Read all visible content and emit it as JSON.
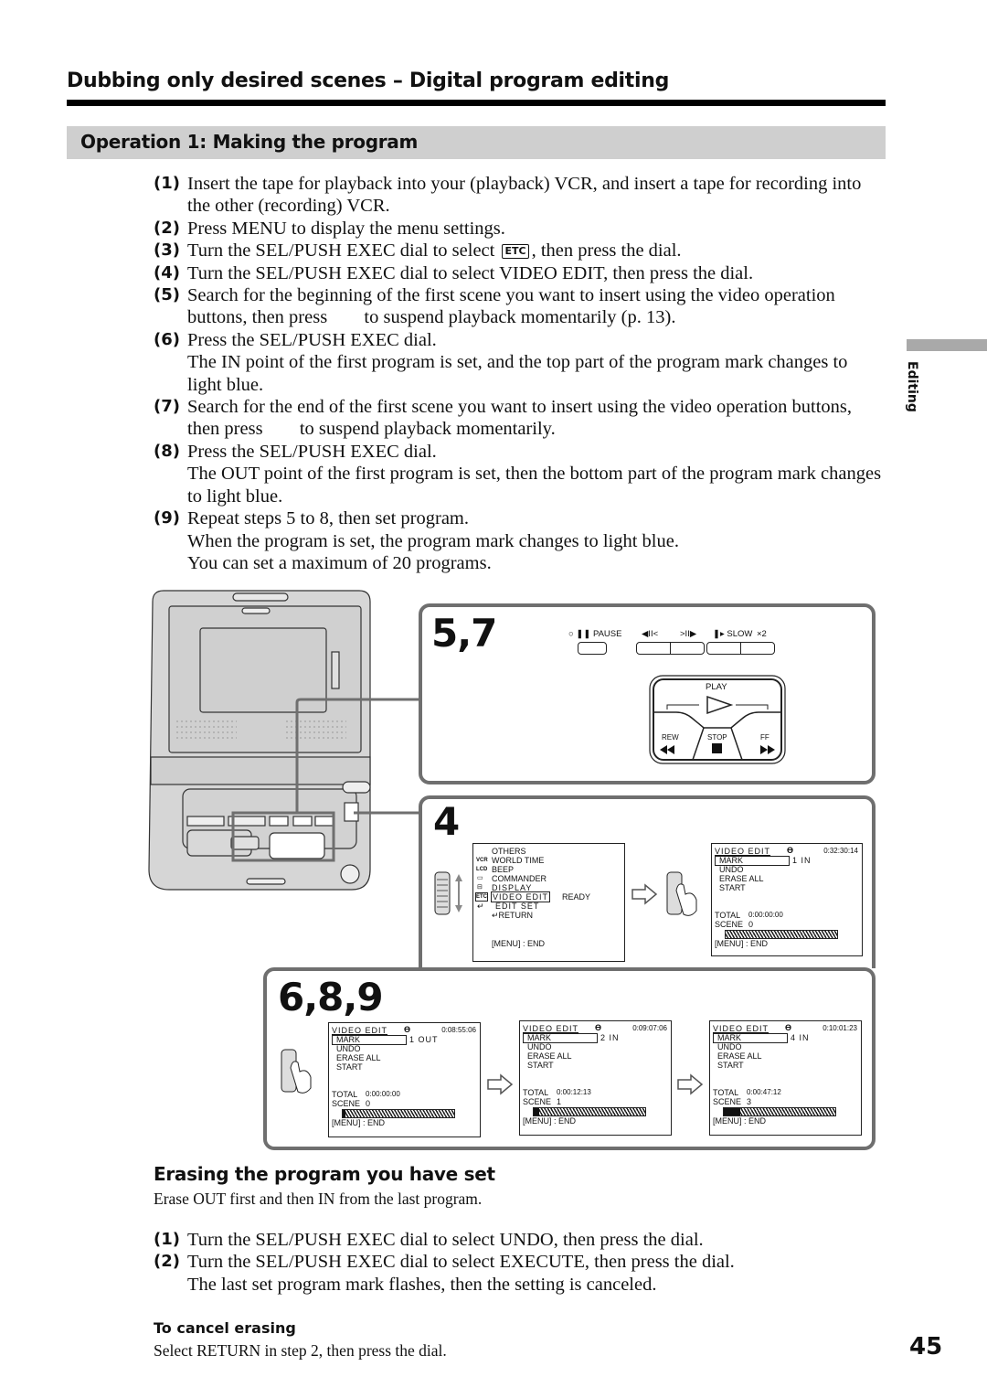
{
  "header": {
    "title": "Dubbing only desired scenes – Digital program editing",
    "section": "Operation 1: Making the program"
  },
  "side_tab": {
    "label": "Editing"
  },
  "steps": [
    {
      "num": "(1)",
      "text": "Insert the tape for playback into your (playback) VCR, and insert a tape for recording into the other (recording) VCR."
    },
    {
      "num": "(2)",
      "text": "Press MENU to display the menu settings."
    },
    {
      "num": "(3)",
      "text_before": "Turn the SEL/PUSH EXEC dial to select ",
      "icon": "ETC",
      "text_after": ", then press the dial."
    },
    {
      "num": "(4)",
      "text": "Turn the SEL/PUSH EXEC dial to select VIDEO EDIT, then press the dial."
    },
    {
      "num": "(5)",
      "text_before": "Search for the beginning of the first scene you want to insert using the video operation buttons, then press ",
      "text_after": " to suspend playback momentarily (p. 13)."
    },
    {
      "num": "(6)",
      "text": "Press the SEL/PUSH EXEC dial.",
      "note": "The IN point of the first program is set, and the top part of the program mark changes to light blue."
    },
    {
      "num": "(7)",
      "text_before": "Search for the end of the first scene you want to insert using the video operation buttons, then press ",
      "text_after": " to suspend playback momentarily."
    },
    {
      "num": "(8)",
      "text": "Press the SEL/PUSH EXEC dial.",
      "note": "The OUT point of the first program is set, then the bottom part of the program mark changes to light blue."
    },
    {
      "num": "(9)",
      "text": "Repeat steps 5 to 8, then set program.",
      "note": "When the program is set, the program mark changes to light blue.",
      "note2": "You can set a maximum of 20 programs."
    }
  ],
  "illustration": {
    "panel_57": {
      "label": "5,7",
      "buttons": {
        "pause": "PAUSE",
        "frame_back": "◀II<",
        "frame_fwd": ">II▶",
        "slow": "SLOW",
        "x2": "×2"
      },
      "transport": {
        "play": "PLAY",
        "rew": "REW",
        "stop": "STOP",
        "ff": "FF"
      }
    },
    "panel_4": {
      "label": "4",
      "menu": {
        "title": "OTHERS",
        "items": [
          "WORLD TIME",
          "BEEP",
          "COMMANDER",
          "DISPLAY",
          "VIDEO EDIT",
          "EDIT SET",
          "RETURN"
        ],
        "selected": "VIDEO EDIT",
        "selected_value": "READY",
        "icons": [
          "VCR",
          "LCD",
          "ETC"
        ],
        "footer": "[MENU] : END"
      },
      "video_edit_screen": {
        "title": "VIDEO EDIT",
        "time": "0:32:30:14",
        "mark": "MARK",
        "mark_value": "1  IN",
        "items": [
          "UNDO",
          "ERASE  ALL",
          "START"
        ],
        "total_label": "TOTAL",
        "total": "0:00:00:00",
        "scene_label": "SCENE",
        "scene": "0",
        "programs_set": 0,
        "programs_max": 20,
        "footer": "[MENU] : END"
      }
    },
    "panel_689": {
      "label": "6,8,9",
      "screens": [
        {
          "title": "VIDEO EDIT",
          "time": "0:08:55:06",
          "mark": "MARK",
          "mark_value": "1  OUT",
          "items": [
            "UNDO",
            "ERASE  ALL",
            "START"
          ],
          "total_label": "TOTAL",
          "total": "0:00:00:00",
          "scene_label": "SCENE",
          "scene": "0",
          "programs_set": 0.5,
          "programs_max": 20,
          "footer": "[MENU] : END"
        },
        {
          "title": "VIDEO EDIT",
          "time": "0:09:07:06",
          "mark": "MARK",
          "mark_value": "2  IN",
          "items": [
            "UNDO",
            "ERASE  ALL",
            "START"
          ],
          "total_label": "TOTAL",
          "total": "0:00:12:13",
          "scene_label": "SCENE",
          "scene": "1",
          "programs_set": 1,
          "programs_max": 20,
          "footer": "[MENU] : END"
        },
        {
          "title": "VIDEO EDIT",
          "time": "0:10:01:23",
          "mark": "MARK",
          "mark_value": "4  IN",
          "items": [
            "UNDO",
            "ERASE  ALL",
            "START"
          ],
          "total_label": "TOTAL",
          "total": "0:00:47:12",
          "scene_label": "SCENE",
          "scene": "3",
          "programs_set": 3,
          "programs_max": 20,
          "footer": "[MENU] : END"
        }
      ]
    }
  },
  "erasing": {
    "title": "Erasing the program you have set",
    "intro": "Erase OUT first and then IN from the last program.",
    "steps": [
      {
        "num": "(1)",
        "text": "Turn the SEL/PUSH EXEC dial to select UNDO, then press the dial."
      },
      {
        "num": "(2)",
        "text": "Turn the SEL/PUSH EXEC dial to select EXECUTE, then press the dial.",
        "note": "The last set program mark flashes, then the setting is canceled."
      }
    ],
    "cancel_title": "To cancel erasing",
    "cancel_text": "Select RETURN in step 2, then press the dial."
  },
  "page_number": "45"
}
